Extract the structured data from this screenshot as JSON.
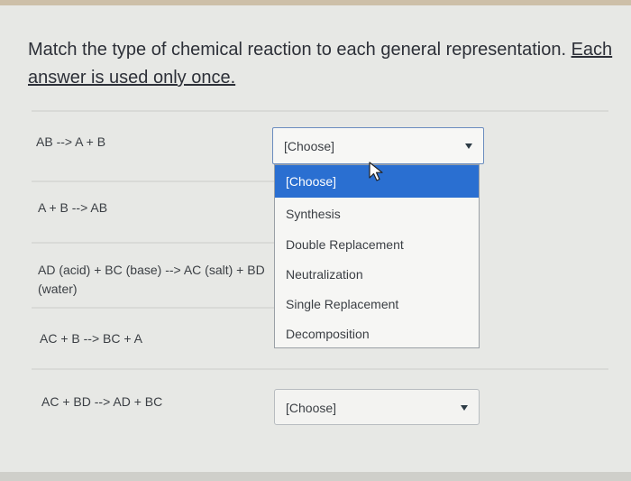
{
  "question": {
    "prompt": "Match the type of chemical reaction to each general representation. ",
    "instruction_part1": "Each",
    "instruction_part2": "answer is used only once."
  },
  "rows": [
    {
      "equation": "AB --> A + B",
      "selected": "[Choose]"
    },
    {
      "equation": "A + B --> AB"
    },
    {
      "equation_line1": "AD (acid) + BC (base) --> AC (salt) + BD",
      "equation_line2": "(water)"
    },
    {
      "equation": "AC + B --> BC + A"
    },
    {
      "equation": "AC + BD --> AD + BC",
      "selected": "[Choose]"
    }
  ],
  "dropdown": {
    "options": [
      "[Choose]",
      "Synthesis",
      "Double Replacement",
      "Neutralization",
      "Single Replacement",
      "Decomposition"
    ],
    "highlighted_index": 0
  }
}
